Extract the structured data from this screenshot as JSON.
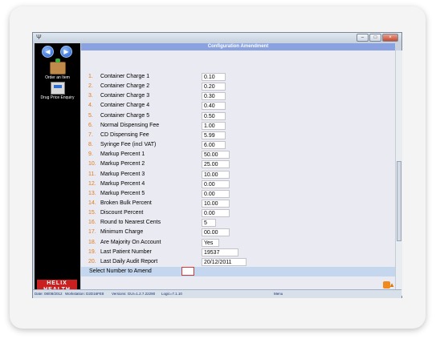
{
  "window": {
    "title": ""
  },
  "sidebar": {
    "items": [
      {
        "label": "Order an Item",
        "icon": "order-cart-icon"
      },
      {
        "label": "Drug Price Enquiry",
        "icon": "cash-register-icon"
      }
    ],
    "logo": {
      "line1": "HELIX",
      "line2": "HEALTH"
    }
  },
  "page": {
    "title": "Configuration Amendment"
  },
  "config": {
    "items": [
      {
        "num": "1.",
        "label": "Container Charge 1",
        "value": "0.10"
      },
      {
        "num": "2.",
        "label": "Container Charge 2",
        "value": "0.20"
      },
      {
        "num": "3.",
        "label": "Container Charge 3",
        "value": "0.30"
      },
      {
        "num": "4.",
        "label": "Container Charge 4",
        "value": "0.40"
      },
      {
        "num": "5.",
        "label": "Container Charge 5",
        "value": "0.50"
      },
      {
        "num": "6.",
        "label": "Normal Dispensing Fee",
        "value": "1.00"
      },
      {
        "num": "7.",
        "label": "CD Dispensing Fee",
        "value": "5.99"
      },
      {
        "num": "8.",
        "label": "Syringe Fee (incl VAT)",
        "value": "6.00"
      },
      {
        "num": "9.",
        "label": "Markup Percent 1",
        "value": "50.00"
      },
      {
        "num": "10.",
        "label": "Markup Percent 2",
        "value": "25.00"
      },
      {
        "num": "11.",
        "label": "Markup Percent 3",
        "value": "10.00"
      },
      {
        "num": "12.",
        "label": "Markup Percent 4",
        "value": "0.00"
      },
      {
        "num": "13.",
        "label": "Markup Percent 5",
        "value": "0.00"
      },
      {
        "num": "14.",
        "label": "Broken Bulk Percent",
        "value": "10.00"
      },
      {
        "num": "15.",
        "label": "Discount Percent",
        "value": "0.00"
      },
      {
        "num": "16.",
        "label": "Round to Nearest Cents",
        "value": "5"
      },
      {
        "num": "17.",
        "label": "Minimum Charge",
        "value": "00.00"
      },
      {
        "num": "18.",
        "label": "Are Majority On Account",
        "value": "Yes"
      },
      {
        "num": "19.",
        "label": "Last Patient Number",
        "value": "19537"
      },
      {
        "num": "20.",
        "label": "Last Daily Audit Report",
        "value": "20/12/2011"
      }
    ]
  },
  "amend": {
    "label": "Select Number to Amend",
    "value": ""
  },
  "status": {
    "date": "Date: 08/08/2012",
    "workstation": "Workstation: D2D16FE8",
    "versions": "Versions: GUI=1.2.7.22290",
    "logic": "Logic=7.1.10",
    "menu": "Menu"
  }
}
